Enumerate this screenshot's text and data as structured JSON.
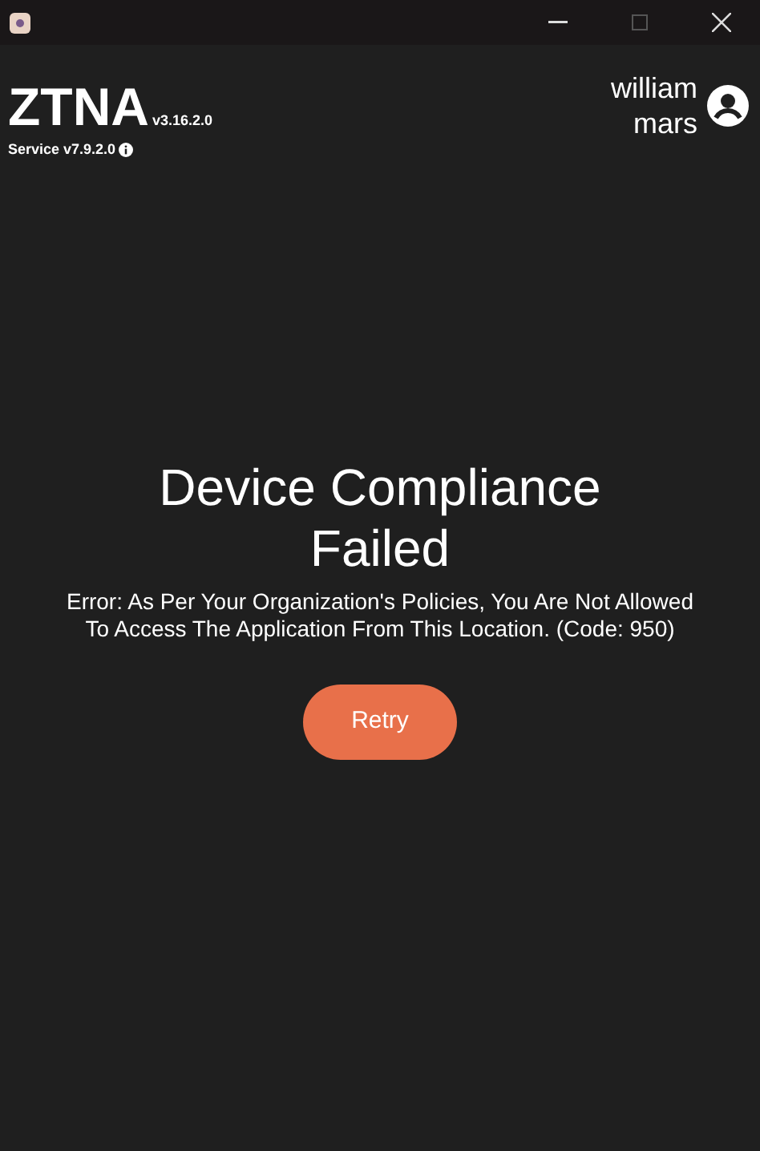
{
  "header": {
    "app_name": "ZTNA",
    "app_version": "v3.16.2.0",
    "service_version": "Service v7.9.2.0",
    "user_name": "william mars"
  },
  "message": {
    "title": "Device Compliance Failed",
    "error": "Error: As Per Your Organization's Policies, You Are Not Allowed To Access The Application From This Location. (Code: 950)"
  },
  "buttons": [
    "Retry"
  ]
}
